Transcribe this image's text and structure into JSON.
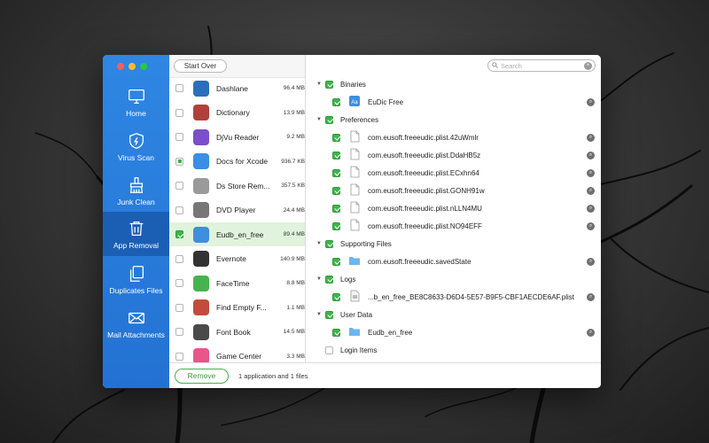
{
  "colors": {
    "sidebar": "#2b7fde",
    "sidebar_active": "#1b5fb4",
    "check_green": "#3db54a",
    "traffic": [
      "#ff5f57",
      "#febc2e",
      "#28c840"
    ]
  },
  "sidebar": {
    "items": [
      {
        "label": "Home",
        "icon": "monitor-icon"
      },
      {
        "label": "Virus Scan",
        "icon": "shield-icon"
      },
      {
        "label": "Junk Clean",
        "icon": "broom-icon"
      },
      {
        "label": "App Removal",
        "icon": "trash-icon",
        "active": true
      },
      {
        "label": "Duplicates Files",
        "icon": "duplicate-icon"
      },
      {
        "label": "Mail Attachments",
        "icon": "mail-icon"
      }
    ]
  },
  "toolbar": {
    "start_over": "Start Over",
    "search_placeholder": "Search"
  },
  "apps": [
    {
      "name": "Dashlane",
      "size": "96.4 MB",
      "checked": "none",
      "icon_color": "#2a6fb8"
    },
    {
      "name": "Dictionary",
      "size": "13.9 MB",
      "checked": "none",
      "icon_color": "#b0413a"
    },
    {
      "name": "DjVu Reader",
      "size": "9.2 MB",
      "checked": "none",
      "icon_color": "#7a4fc9"
    },
    {
      "name": "Docs for Xcode",
      "size": "936.7 KB",
      "checked": "partial",
      "icon_color": "#3a8ee6"
    },
    {
      "name": "Ds Store Rem...",
      "size": "357.5 KB",
      "checked": "none",
      "icon_color": "#9a9a9a"
    },
    {
      "name": "DVD Player",
      "size": "24.4 MB",
      "checked": "none",
      "icon_color": "#777777"
    },
    {
      "name": "Eudb_en_free",
      "size": "89.4 MB",
      "checked": "checked",
      "icon_color": "#3f8ee0",
      "selected": true
    },
    {
      "name": "Evernote",
      "size": "140.9 MB",
      "checked": "none",
      "icon_color": "#333333"
    },
    {
      "name": "FaceTime",
      "size": "8.8 MB",
      "checked": "none",
      "icon_color": "#46b34f"
    },
    {
      "name": "Find Empty F...",
      "size": "1.1 MB",
      "checked": "none",
      "icon_color": "#c44b3c"
    },
    {
      "name": "Font Book",
      "size": "14.5 MB",
      "checked": "none",
      "icon_color": "#4a4a4a"
    },
    {
      "name": "Game Center",
      "size": "3.3 MB",
      "checked": "none",
      "icon_color": "#e8568a"
    }
  ],
  "details": [
    {
      "type": "group",
      "label": "Binaries",
      "checked": "checked"
    },
    {
      "type": "item",
      "label": "EuDic Free",
      "icon": "app-icon",
      "checked": "checked"
    },
    {
      "type": "group",
      "label": "Preferences",
      "checked": "checked"
    },
    {
      "type": "item",
      "label": "com.eusoft.freeeudic.plist.42uWmlr",
      "icon": "document-icon",
      "checked": "checked"
    },
    {
      "type": "item",
      "label": "com.eusoft.freeeudic.plist.DdaHB5z",
      "icon": "document-icon",
      "checked": "checked"
    },
    {
      "type": "item",
      "label": "com.eusoft.freeeudic.plist.ECxhn64",
      "icon": "document-icon",
      "checked": "checked"
    },
    {
      "type": "item",
      "label": "com.eusoft.freeeudic.plist.GONH91w",
      "icon": "document-icon",
      "checked": "checked"
    },
    {
      "type": "item",
      "label": "com.eusoft.freeeudic.plist.nLLN4MU",
      "icon": "document-icon",
      "checked": "checked"
    },
    {
      "type": "item",
      "label": "com.eusoft.freeeudic.plist.NO94EFF",
      "icon": "document-icon",
      "checked": "checked"
    },
    {
      "type": "group",
      "label": "Supporting Files",
      "checked": "checked"
    },
    {
      "type": "item",
      "label": "com.eusoft.freeeudic.savedState",
      "icon": "folder-icon",
      "checked": "checked"
    },
    {
      "type": "group",
      "label": "Logs",
      "checked": "checked"
    },
    {
      "type": "item",
      "label": "...b_en_free_BE8C8633-D6D4-5E57-B9F5-CBF1AECDE6AF.plist",
      "icon": "plist-icon",
      "checked": "checked"
    },
    {
      "type": "group",
      "label": "User Data",
      "checked": "checked"
    },
    {
      "type": "item",
      "label": "Eudb_en_free",
      "icon": "folder-icon",
      "checked": "checked"
    },
    {
      "type": "group",
      "label": "Login Items",
      "checked": "none",
      "no_arrow": true
    }
  ],
  "footer": {
    "remove_label": "Remove",
    "summary": "1 application and 1 files"
  }
}
